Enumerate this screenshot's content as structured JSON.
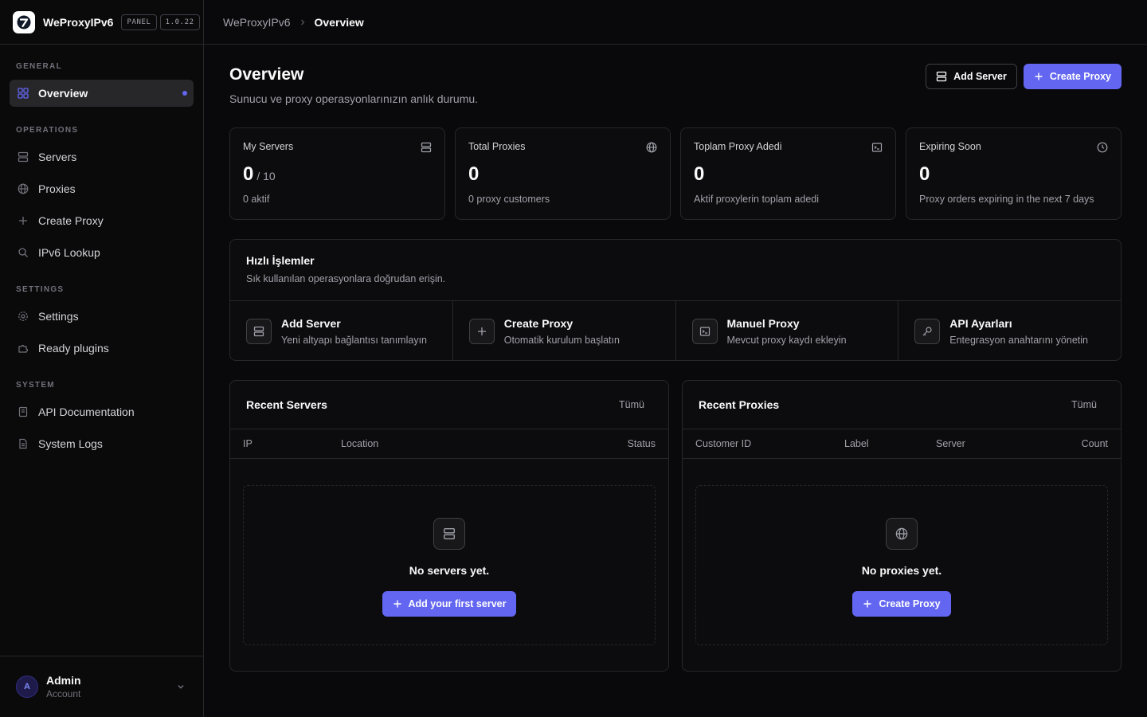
{
  "brand": {
    "name": "WeProxyIPv6",
    "badge": "PANEL",
    "version": "1.0.22"
  },
  "breadcrumb": {
    "root": "WeProxyIPv6",
    "current": "Overview"
  },
  "sidebar": {
    "general": {
      "label": "GENERAL",
      "items": [
        {
          "label": "Overview",
          "icon": "grid-icon"
        }
      ]
    },
    "operations": {
      "label": "OPERATIONS",
      "items": [
        {
          "label": "Servers",
          "icon": "server-icon"
        },
        {
          "label": "Proxies",
          "icon": "globe-icon"
        },
        {
          "label": "Create Proxy",
          "icon": "plus-icon"
        },
        {
          "label": "IPv6 Lookup",
          "icon": "search-icon"
        }
      ]
    },
    "settings": {
      "label": "SETTINGS",
      "items": [
        {
          "label": "Settings",
          "icon": "gear-icon"
        },
        {
          "label": "Ready plugins",
          "icon": "puzzle-icon"
        }
      ]
    },
    "system": {
      "label": "SYSTEM",
      "items": [
        {
          "label": "API Documentation",
          "icon": "book-icon"
        },
        {
          "label": "System Logs",
          "icon": "file-icon"
        }
      ]
    }
  },
  "user": {
    "initial": "A",
    "name": "Admin",
    "role": "Account"
  },
  "page": {
    "title": "Overview",
    "subtitle": "Sunucu ve proxy operasyonlarınızın anlık durumu.",
    "add_server": "Add Server",
    "create_proxy": "Create Proxy"
  },
  "stats": [
    {
      "label": "My Servers",
      "value": "0",
      "suffix": "/ 10",
      "note": "0 aktif",
      "icon": "server-icon"
    },
    {
      "label": "Total Proxies",
      "value": "0",
      "suffix": "",
      "note": "0 proxy customers",
      "icon": "globe-icon"
    },
    {
      "label": "Toplam Proxy Adedi",
      "value": "0",
      "suffix": "",
      "note": "Aktif proxylerin toplam adedi",
      "icon": "terminal-icon"
    },
    {
      "label": "Expiring Soon",
      "value": "0",
      "suffix": "",
      "note": "Proxy orders expiring in the next 7 days",
      "icon": "clock-icon"
    }
  ],
  "quick": {
    "title": "Hızlı İşlemler",
    "subtitle": "Sık kullanılan operasyonlara doğrudan erişin.",
    "actions": [
      {
        "title": "Add Server",
        "sub": "Yeni altyapı bağlantısı tanımlayın",
        "icon": "server-icon"
      },
      {
        "title": "Create Proxy",
        "sub": "Otomatik kurulum başlatın",
        "icon": "plus-icon"
      },
      {
        "title": "Manuel Proxy",
        "sub": "Mevcut proxy kaydı ekleyin",
        "icon": "terminal-icon"
      },
      {
        "title": "API Ayarları",
        "sub": "Entegrasyon anahtarını yönetin",
        "icon": "key-icon"
      }
    ]
  },
  "recent_servers": {
    "title": "Recent Servers",
    "link": "Tümü",
    "columns": [
      "IP",
      "Location",
      "Status"
    ],
    "empty_text": "No servers yet.",
    "empty_button": "Add your first server"
  },
  "recent_proxies": {
    "title": "Recent Proxies",
    "link": "Tümü",
    "columns": [
      "Customer ID",
      "Label",
      "Server",
      "Count"
    ],
    "empty_text": "No proxies yet.",
    "empty_button": "Create Proxy"
  },
  "colors": {
    "accent": "#6366f1",
    "background": "#09090b",
    "border": "#27272a"
  }
}
